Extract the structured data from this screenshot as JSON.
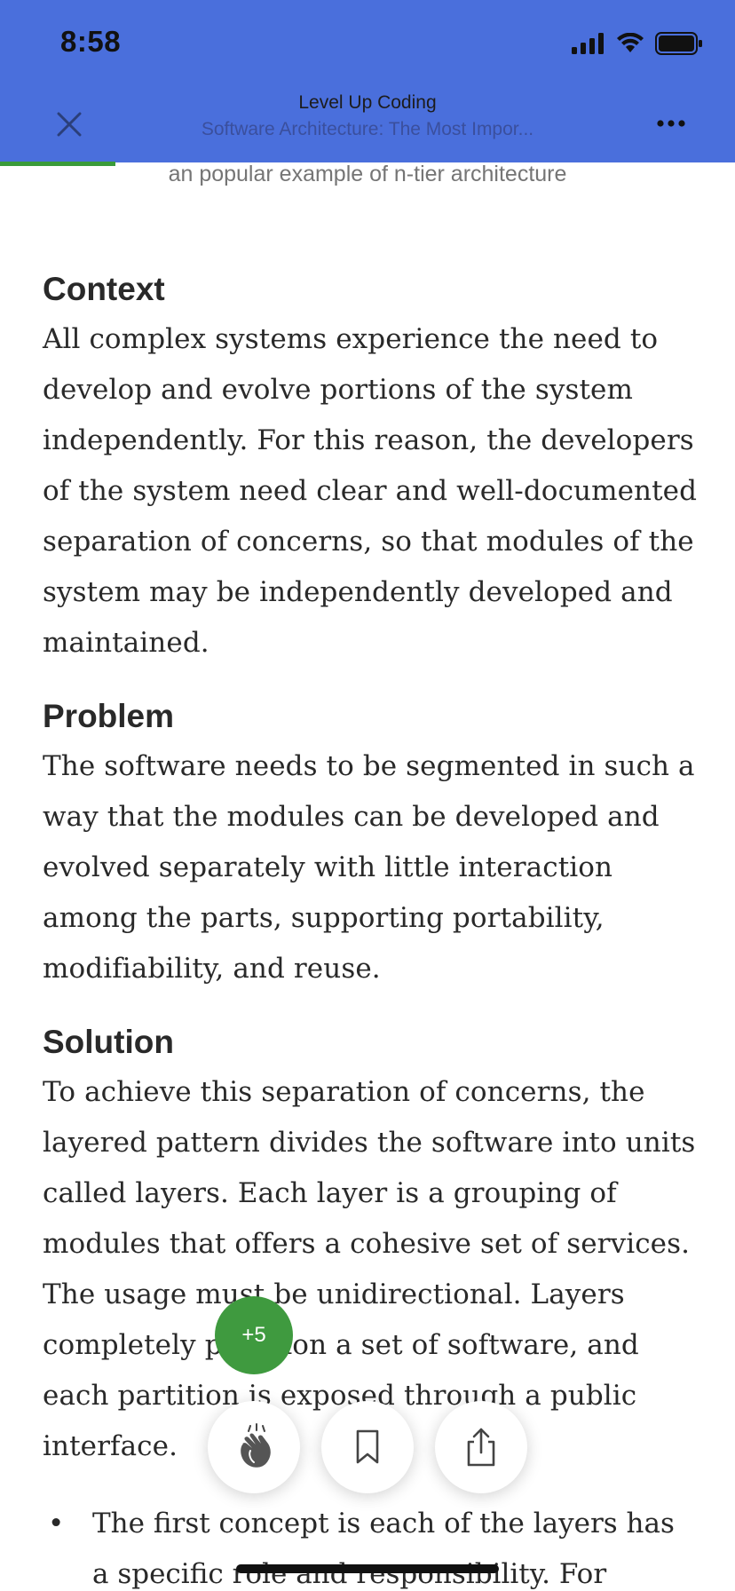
{
  "status_bar": {
    "time": "8:58"
  },
  "header": {
    "publication": "Level Up Coding",
    "article_title": "Software Architecture: The Most Impor..."
  },
  "caption": "an popular example of n-tier architecture",
  "sections": [
    {
      "heading": "Context",
      "body": "All complex systems experience the need to develop and evolve portions of the system independently. For this reason, the developers of the system need clear and well-documented separation of concerns, so that modules of the system may be independently developed and maintained."
    },
    {
      "heading": "Problem",
      "body": "The software needs to be segmented in such a way that the modules can be developed and evolved separately with little interaction among the parts, supporting portability, modifiability, and reuse."
    },
    {
      "heading": "Solution",
      "body": "To achieve this separation of concerns, the layered pattern divides the software into units called layers. Each layer is a grouping of modules that offers a cohesive set of services. The usage must be unidirectional. Layers completely partition a set of software, and each partition is exposed through a public interface."
    }
  ],
  "bullet": {
    "symbol": "•",
    "text": "The first concept is each of the layers has a specific role and responsibility. For"
  },
  "clap_badge": "+5",
  "colors": {
    "header": "#4a6fdc",
    "accent_green": "#3f9a3f"
  },
  "icons": [
    "close-icon",
    "more-icon",
    "clap-icon",
    "bookmark-icon",
    "share-icon",
    "signal-icon",
    "wifi-icon",
    "battery-icon"
  ]
}
